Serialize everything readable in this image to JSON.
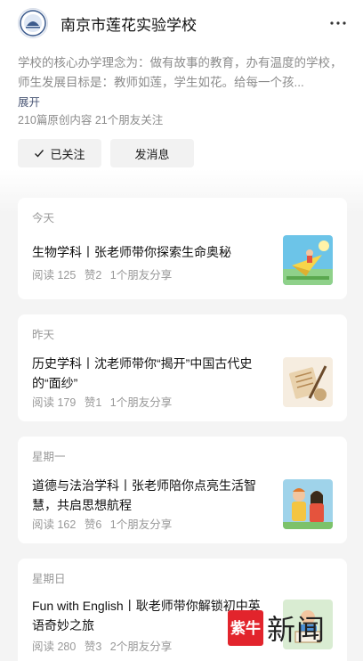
{
  "account": {
    "name": "南京市莲花实验学校",
    "description": "学校的核心办学理念为：做有故事的教育，办有温度的学校，师生发展目标是：教师如莲，学生如花。给每一个孩...",
    "expand_label": "展开",
    "stats": "210篇原创内容  21个朋友关注",
    "follow_label": "已关注",
    "message_label": "发消息"
  },
  "articles": [
    {
      "day": "今天",
      "title": "生物学科丨张老师带你探索生命奥秘",
      "read": "阅读 125",
      "like": "赞2",
      "share": "1个朋友分享",
      "thumb_icon": "paper-plane-girl-illustration"
    },
    {
      "day": "昨天",
      "title": "历史学科丨沈老师带你“揭开”中国古代史的“面纱”",
      "read": "阅读 179",
      "like": "赞1",
      "share": "1个朋友分享",
      "thumb_icon": "scroll-brush-illustration"
    },
    {
      "day": "星期一",
      "title": "道德与法治学科丨张老师陪你点亮生活智慧，共启思想航程",
      "read": "阅读 162",
      "like": "赞6",
      "share": "1个朋友分享",
      "thumb_icon": "students-illustration"
    },
    {
      "day": "星期日",
      "title": "Fun with English丨耿老师带你解锁初中英语奇妙之旅",
      "read": "阅读 280",
      "like": "赞3",
      "share": "2个朋友分享",
      "thumb_icon": "reading-illustration"
    }
  ],
  "watermark": {
    "badge": "紫牛",
    "text": "新闻"
  },
  "colors": {
    "link": "#4e5a78",
    "watermark_red": "#e2242c"
  }
}
